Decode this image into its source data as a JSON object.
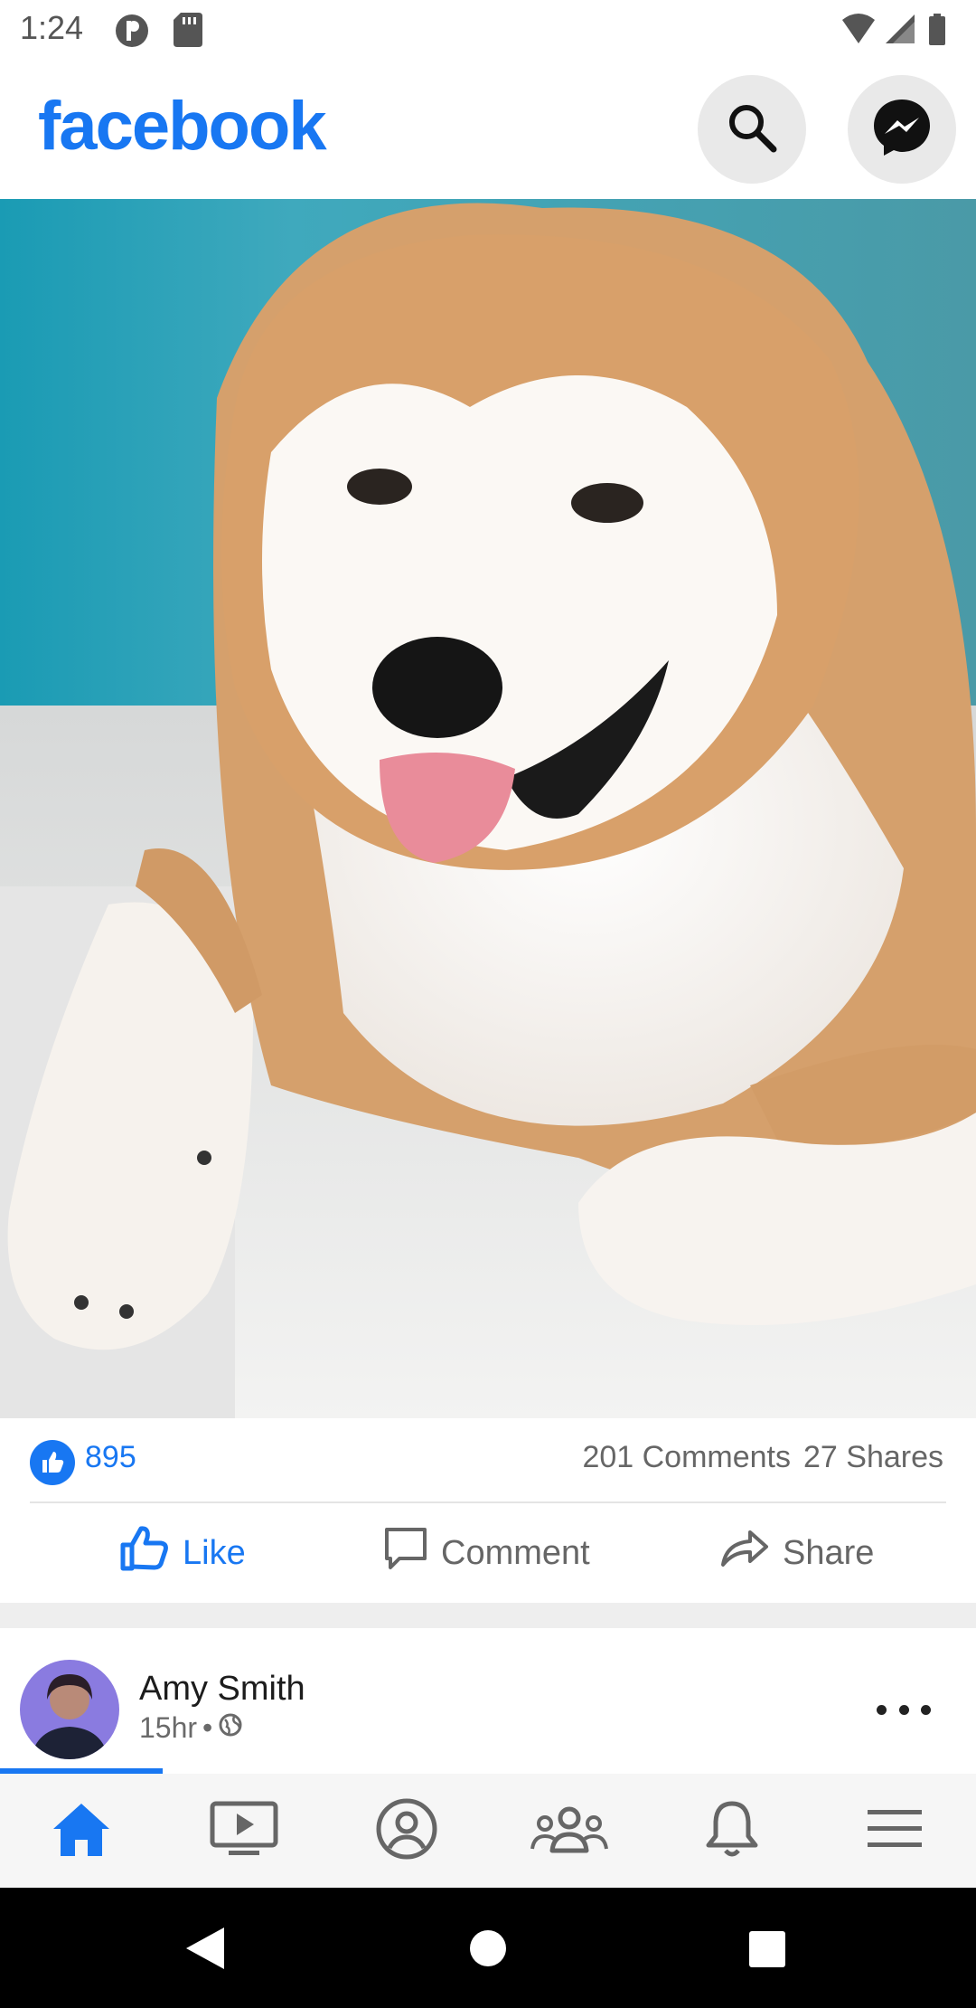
{
  "status_bar": {
    "time": "1:24"
  },
  "header": {
    "brand": "facebook",
    "brand_color": "#1877f2",
    "search_icon": "search-icon",
    "messenger_icon": "messenger-icon"
  },
  "post": {
    "photo": "photo of a shiba inu dog",
    "like_count": "895",
    "comments": "201 Comments",
    "shares": "27 Shares",
    "actions": {
      "like": "Like",
      "comment": "Comment",
      "share": "Share"
    }
  },
  "next_post": {
    "author": "Amy Smith",
    "time": "15hr",
    "separator": "•",
    "privacy_icon": "globe-icon"
  },
  "bottom_nav": {
    "active": "home",
    "items": [
      "home-icon",
      "watch-icon",
      "profile-icon",
      "groups-icon",
      "notifications-icon",
      "menu-icon"
    ]
  },
  "system_nav": [
    "back",
    "home",
    "recents"
  ]
}
